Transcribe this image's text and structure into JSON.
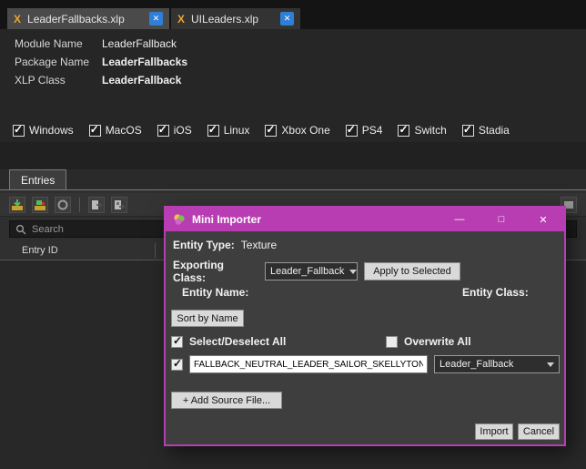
{
  "accent": "#b83db2",
  "window": {
    "tabs": [
      {
        "icon": "X",
        "label": "LeaderFallbacks.xlp",
        "close": "✕",
        "active": true
      },
      {
        "icon": "X",
        "label": "UILeaders.xlp",
        "close": "✕",
        "active": false
      }
    ],
    "properties": [
      {
        "label": "Module Name",
        "value": "LeaderFallback",
        "bold": false
      },
      {
        "label": "Package Name",
        "value": "LeaderFallbacks",
        "bold": true
      },
      {
        "label": "XLP Class",
        "value": "LeaderFallback",
        "bold": true
      }
    ],
    "platforms": [
      {
        "label": "Windows",
        "checked": true
      },
      {
        "label": "MacOS",
        "checked": true
      },
      {
        "label": "iOS",
        "checked": true
      },
      {
        "label": "Linux",
        "checked": true
      },
      {
        "label": "Xbox One",
        "checked": true
      },
      {
        "label": "PS4",
        "checked": true
      },
      {
        "label": "Switch",
        "checked": true
      },
      {
        "label": "Stadia",
        "checked": true
      }
    ],
    "entries": {
      "tab_label": "Entries",
      "search_placeholder": "Search",
      "column_header": "Entry ID"
    }
  },
  "dialog": {
    "title": "Mini Importer",
    "controls": {
      "minimize": "—",
      "maximize": "□",
      "close": "✕"
    },
    "entity_type": {
      "label": "Entity Type:",
      "value": "Texture"
    },
    "exporting_class": {
      "label": "Exporting Class:",
      "value": "Leader_Fallback"
    },
    "apply_button": "Apply to Selected",
    "entity_name_label": "Entity Name:",
    "entity_class_label": "Entity Class:",
    "sort_button": "Sort by Name",
    "select_all": {
      "label": "Select/Deselect All",
      "checked": true
    },
    "overwrite_all": {
      "label": "Overwrite All",
      "checked": false
    },
    "entries": [
      {
        "checked": true,
        "name": "FALLBACK_NEUTRAL_LEADER_SAILOR_SKELLYTON",
        "class": "Leader_Fallback"
      }
    ],
    "add_source_button": "+ Add Source File...",
    "import_button": "Import",
    "cancel_button": "Cancel"
  }
}
